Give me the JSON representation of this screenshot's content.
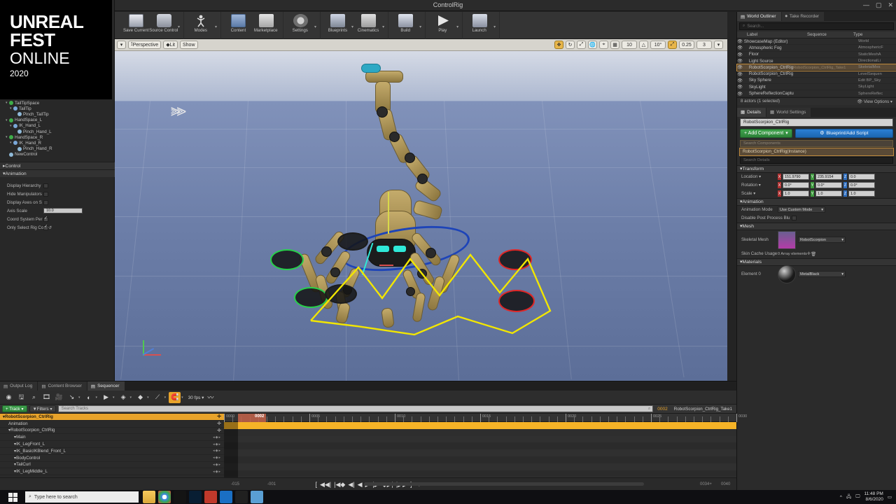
{
  "window": {
    "title": "ControlRig",
    "minimize": "—",
    "maximize": "▢",
    "close": "✕"
  },
  "logo": {
    "line1": "UNREAL",
    "line2": "FEST",
    "line3": "ONLINE",
    "year": "2020"
  },
  "toolbar": {
    "items": [
      {
        "label": "Save Current",
        "icon": "save-icon",
        "caret": false
      },
      {
        "label": "Source Control",
        "icon": "source-control-icon",
        "caret": true
      },
      {
        "label": "Modes",
        "icon": "modes-icon",
        "caret": true
      },
      {
        "label": "Content",
        "icon": "content-icon",
        "caret": false
      },
      {
        "label": "Marketplace",
        "icon": "marketplace-icon",
        "caret": false
      },
      {
        "label": "Settings",
        "icon": "settings-icon",
        "caret": true
      },
      {
        "label": "Blueprints",
        "icon": "blueprints-icon",
        "caret": true
      },
      {
        "label": "Cinematics",
        "icon": "cinematics-icon",
        "caret": true
      },
      {
        "label": "Build",
        "icon": "build-icon",
        "caret": true
      },
      {
        "label": "Play",
        "icon": "play-icon",
        "caret": true
      },
      {
        "label": "Launch",
        "icon": "launch-icon",
        "caret": true
      }
    ]
  },
  "viewport": {
    "left_controls": [
      {
        "label": "Perspective",
        "icon": "camera-icon"
      },
      {
        "label": "Lit",
        "icon": "lighting-icon"
      },
      {
        "label": "Show",
        "icon": "show-icon"
      }
    ],
    "right_controls": [
      {
        "icon": "select-translate-icon",
        "label": "",
        "active": true
      },
      {
        "icon": "rotate-icon",
        "label": ""
      },
      {
        "icon": "scale-icon",
        "label": ""
      },
      {
        "icon": "world-coord-icon",
        "label": ""
      },
      {
        "icon": "surface-snap-icon",
        "label": ""
      },
      {
        "icon": "grid-snap-icon",
        "label": ""
      },
      {
        "icon": "grid-value-icon",
        "label": "10"
      },
      {
        "icon": "angle-snap-icon",
        "label": ""
      },
      {
        "icon": "angle-value-icon",
        "label": "10°"
      },
      {
        "icon": "scale-snap-icon",
        "label": "",
        "active": true
      },
      {
        "icon": "scale-value-icon",
        "label": "0.25"
      },
      {
        "icon": "camera-speed-icon",
        "label": "3"
      }
    ]
  },
  "rig_tree": {
    "items": [
      {
        "label": "TailTipSpace",
        "indent": 1,
        "dot": "g",
        "arrow": "▾"
      },
      {
        "label": "TailTip",
        "indent": 2,
        "dot": "b",
        "arrow": "▾"
      },
      {
        "label": "Pinch_TailTip",
        "indent": 3,
        "dot": "c",
        "arrow": ""
      },
      {
        "label": "HandSpace_L",
        "indent": 1,
        "dot": "g",
        "arrow": "▾"
      },
      {
        "label": "IK_Hand_L",
        "indent": 2,
        "dot": "b",
        "arrow": "▾"
      },
      {
        "label": "Pinch_Hand_L",
        "indent": 3,
        "dot": "c",
        "arrow": ""
      },
      {
        "label": "HandSpace_R",
        "indent": 1,
        "dot": "g",
        "arrow": "▾"
      },
      {
        "label": "IK_Hand_R",
        "indent": 2,
        "dot": "b",
        "arrow": "▾"
      },
      {
        "label": "Pinch_Hand_R",
        "indent": 3,
        "dot": "c",
        "arrow": ""
      },
      {
        "label": "NewControl",
        "indent": 1,
        "dot": "c",
        "arrow": ""
      }
    ]
  },
  "rig_sections": {
    "control": {
      "label": "Control",
      "arrow": "▸"
    },
    "animation": {
      "label": "Animation",
      "arrow": "▾"
    },
    "properties": [
      {
        "label": "Display Hierarchy",
        "type": "checkbox",
        "checked": false
      },
      {
        "label": "Hide Manipulators",
        "type": "checkbox",
        "checked": false
      },
      {
        "label": "Display Axes on S",
        "type": "checkbox",
        "checked": false
      },
      {
        "label": "Axis Scale",
        "type": "number",
        "value": "10.0"
      },
      {
        "label": "Coord System Per",
        "type": "checkbox",
        "checked": true
      },
      {
        "label": "Only Select Rig Co",
        "type": "checkbox",
        "checked": true,
        "reset": "↺"
      }
    ]
  },
  "outliner": {
    "tabs": [
      {
        "label": "World Outliner",
        "icon": "world-outliner-icon",
        "active": true
      },
      {
        "label": "Take Recorder",
        "icon": "take-recorder-icon",
        "active": false
      }
    ],
    "search_placeholder": "Search...",
    "columns": {
      "label": "Label",
      "sequence": "Sequence",
      "type": "Type"
    },
    "rows": [
      {
        "label": "ShowcaseMap (Editor)",
        "type": "World",
        "indent": 0,
        "selected": false
      },
      {
        "label": "Atmospheric Fog",
        "type": "AtmosphericF",
        "indent": 1,
        "selected": false
      },
      {
        "label": "Floor",
        "type": "StaticMeshA",
        "indent": 1,
        "selected": false
      },
      {
        "label": "Light Source",
        "type": "DirectionalLi",
        "indent": 1,
        "selected": false
      },
      {
        "label": "RobotScorpion_CtrlRig",
        "sequence": "RobotScorpion_CtrlRig_Take1",
        "type": "SkeletalMes",
        "indent": 1,
        "selected": true
      },
      {
        "label": "RobotScorpion_CtrlRig",
        "type": "LevelSequen",
        "indent": 1,
        "selected": false
      },
      {
        "label": "Sky Sphere",
        "type": "Edit BP_Sky",
        "indent": 1,
        "selected": false
      },
      {
        "label": "SkyLight",
        "type": "SkyLight",
        "indent": 1,
        "selected": false
      },
      {
        "label": "SphereReflectionCaptu",
        "type": "SphereReflec",
        "indent": 1,
        "selected": false
      }
    ],
    "status": "8 actors (1 selected)",
    "view_options": "View Options"
  },
  "details": {
    "tabs": [
      {
        "label": "Details",
        "icon": "details-icon",
        "active": true
      },
      {
        "label": "World Settings",
        "icon": "world-settings-icon",
        "active": false
      }
    ],
    "actor_name": "RobotScorpion_CtrlRig",
    "add_component": "+ Add Component",
    "add_component_caret": "▾",
    "blueprint_button": "Blueprint/Add Script",
    "search_components_placeholder": "Search Components",
    "component_row": "RobotScorpion_CtrlRig(Instance)",
    "search_details_placeholder": "Search Details",
    "groups": {
      "transform": {
        "label": "Transform",
        "rows": [
          {
            "label": "Location",
            "x": "151.9790",
            "y": "235.9154",
            "z": "0.0"
          },
          {
            "label": "Rotation",
            "x": "0.0°",
            "y": "0.0°",
            "z": "0.0°"
          },
          {
            "label": "Scale",
            "x": "1.0",
            "y": "1.0",
            "z": "1.0"
          }
        ]
      },
      "animation": {
        "label": "Animation",
        "mode_label": "Animation Mode",
        "mode_value": "Use Custom Mode",
        "disable_post_label": "Disable Post Process Blu"
      },
      "mesh": {
        "label": "Mesh",
        "skeletal_label": "Skeletal Mesh",
        "skeletal_value": "RobotScorpion",
        "skin_cache_label": "Skin Cache Usage",
        "skin_cache_value": "0 Array elements"
      },
      "materials": {
        "label": "Materials",
        "element_label": "Element 0",
        "element_value": "MetalBlack"
      }
    }
  },
  "sequencer": {
    "tabs": [
      {
        "label": "Output Log",
        "icon": "output-log-icon",
        "active": false
      },
      {
        "label": "Content Browser",
        "icon": "content-browser-icon",
        "active": false
      },
      {
        "label": "Sequencer",
        "icon": "sequencer-icon",
        "active": true
      }
    ],
    "toolbar_icons": [
      "general-options-icon",
      "save-sequence-icon",
      "find-icon",
      "render-movie-icon",
      "create-camera-icon",
      "key-interp-icon",
      "auto-key-icon",
      "playback-range-icon",
      "keyframe-icon",
      "snap-icon",
      "curve-icon",
      "magnet-icon"
    ],
    "fps": "30 fps",
    "add_track": "+ Track",
    "filters": "Filters",
    "search_placeholder": "Search Tracks",
    "current_frame": "0002",
    "take_label": "RobotScorpion_CtrlRig_Take1",
    "tracks": [
      {
        "label": "RobotScorpion_CtrlRig",
        "type": "header",
        "indent": 0
      },
      {
        "label": "Animation",
        "type": "sub",
        "indent": 1
      },
      {
        "label": "RobotScorpion_CtrlRig",
        "type": "group",
        "indent": 1
      },
      {
        "label": "Main",
        "type": "track",
        "indent": 2
      },
      {
        "label": "IK_LegFront_L",
        "type": "track",
        "indent": 2
      },
      {
        "label": "IK_BasicIKBlend_Front_L",
        "type": "track",
        "indent": 2
      },
      {
        "label": "BodyControl",
        "type": "track",
        "indent": 2
      },
      {
        "label": "TailCurl",
        "type": "track",
        "indent": 2
      },
      {
        "label": "IK_LegMiddle_L",
        "type": "track",
        "indent": 2
      }
    ],
    "ruler_labels": [
      "0000",
      "0005",
      "0010",
      "0015",
      "0020",
      "0025",
      "0030"
    ],
    "transport": {
      "buttons": [
        "[",
        "◀◀|",
        "|◀◆",
        "◀|",
        "◀",
        "▶",
        "|▶",
        "◆▶|",
        "|▶▶",
        "]",
        "→"
      ],
      "range_start": "-015",
      "range_in": "-001",
      "range_out": "0034+",
      "range_end": "0040"
    }
  },
  "taskbar": {
    "search_placeholder": "Type here to search",
    "apps": [
      "file-explorer-icon",
      "chrome-icon",
      "terminal-icon",
      "photoshop-icon",
      "vegas-icon",
      "unreal-icon",
      "obs-icon",
      "sketch-icon"
    ],
    "tray": {
      "chevron": "^",
      "network": "network-icon",
      "display": "display-icon"
    },
    "time": "11:48 PM",
    "date": "8/6/2020"
  }
}
